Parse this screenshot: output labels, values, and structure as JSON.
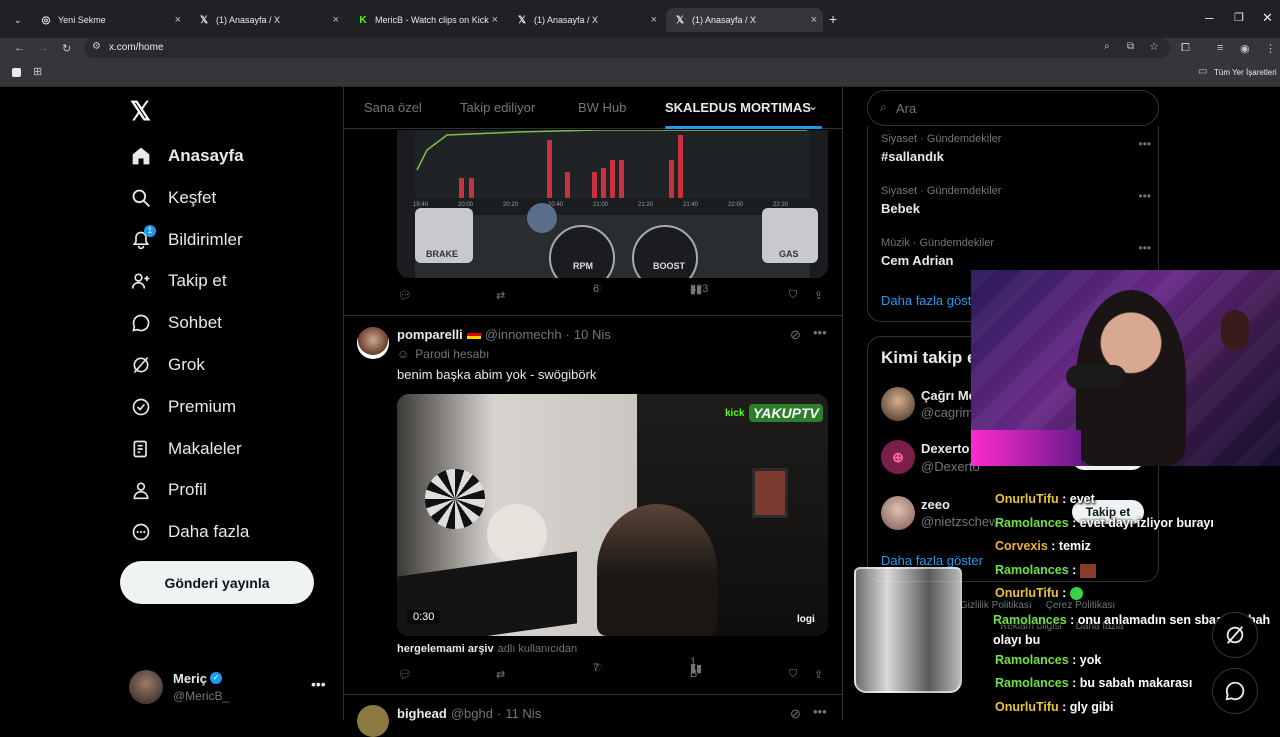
{
  "browser": {
    "tabs": [
      {
        "title": "Yeni Sekme"
      },
      {
        "title": "(1) Anasayfa / X"
      },
      {
        "title": "MericB - Watch clips on Kick"
      },
      {
        "title": "(1) Anasayfa / X"
      },
      {
        "title": "(1) Anasayfa / X"
      }
    ],
    "url": "x.com/home",
    "bookmarks_label": "Tüm Yer İşaretleri"
  },
  "nav": {
    "items": [
      {
        "label": "Anasayfa"
      },
      {
        "label": "Keşfet"
      },
      {
        "label": "Bildirimler",
        "badge": "1"
      },
      {
        "label": "Takip et"
      },
      {
        "label": "Sohbet"
      },
      {
        "label": "Grok"
      },
      {
        "label": "Premium"
      },
      {
        "label": "Makaleler"
      },
      {
        "label": "Profil"
      },
      {
        "label": "Daha fazla"
      }
    ],
    "post_button": "Gönderi yayınla",
    "account": {
      "name": "Meriç",
      "handle": "@MericB_"
    }
  },
  "feed": {
    "tabs": [
      "Sana özel",
      "Takip ediliyor",
      "BW Hub",
      "SKALEDUS MORTIMAS"
    ],
    "post1": {
      "chart_times": [
        "19:40",
        "20:00",
        "20:20",
        "20:40",
        "21:00",
        "21:20",
        "21:40",
        "22:00",
        "22:20"
      ],
      "brake": "BRAKE",
      "gas": "GAS",
      "rpm": "RPM",
      "boost": "BOOST",
      "likes": "6",
      "views": "323"
    },
    "post2": {
      "name": "pomparelli",
      "handle": "@innomechh",
      "date": "10 Nis",
      "parody": "Parodi hesabı",
      "text": "benim başka abim yok - swögibörk",
      "video_time": "0:30",
      "video_logo": "YAKUPTV",
      "video_brand": "logi",
      "source_user": "hergelemami arşiv",
      "source_suffix": "adlı kullanıcıdan",
      "likes": "7",
      "views": "1 B"
    },
    "post3": {
      "name": "bighead",
      "handle": "@bghd",
      "date": "11 Nis"
    }
  },
  "sidebar": {
    "search_placeholder": "Ara",
    "trends": [
      {
        "meta": "Siyaset · Gündemdekiler",
        "name": "#sallandık"
      },
      {
        "meta": "Siyaset · Gündemdekiler",
        "name": "Bebek"
      },
      {
        "meta": "Müzik · Gündemdekiler",
        "name": "Cem Adrian"
      }
    ],
    "show_more": "Daha fazla göster",
    "who_to_follow_title": "Kimi takip e",
    "follow": [
      {
        "name": "Çağrı Me",
        "handle": "@cagrim"
      },
      {
        "name": "Dexerto",
        "handle": "@Dexerto"
      },
      {
        "name": "zeeo",
        "handle": "@nietzschew"
      }
    ],
    "follow_button": "Takip et",
    "show_more2": "Daha fazla göster",
    "footer": [
      "Gizlilik Politikası",
      "Çerez Politikası",
      "Reklam bilgisi",
      "Daha fazla"
    ]
  },
  "chat": [
    {
      "user": "OnurluTifu",
      "color": "#e8c33a",
      "msg": "evet"
    },
    {
      "user": "Ramolances",
      "color": "#6fe04a",
      "msg": "evet dayı izliyor burayı"
    },
    {
      "user": "Corvexis",
      "color": "#f0b030",
      "msg": "temiz"
    },
    {
      "user": "Ramolances",
      "color": "#6fe04a",
      "msg": ""
    },
    {
      "user": "OnurluTifu",
      "color": "#e8c33a",
      "msg": ""
    },
    {
      "user": "Ramolances",
      "color": "#6fe04a",
      "msg": "onu anlamadın sen sbaah sabah olayı bu"
    },
    {
      "user": "Ramolances",
      "color": "#6fe04a",
      "msg": "yok"
    },
    {
      "user": "Ramolances",
      "color": "#6fe04a",
      "msg": "bu sabah makarası"
    },
    {
      "user": "OnurluTifu",
      "color": "#e8c33a",
      "msg": "gly gibi"
    }
  ]
}
